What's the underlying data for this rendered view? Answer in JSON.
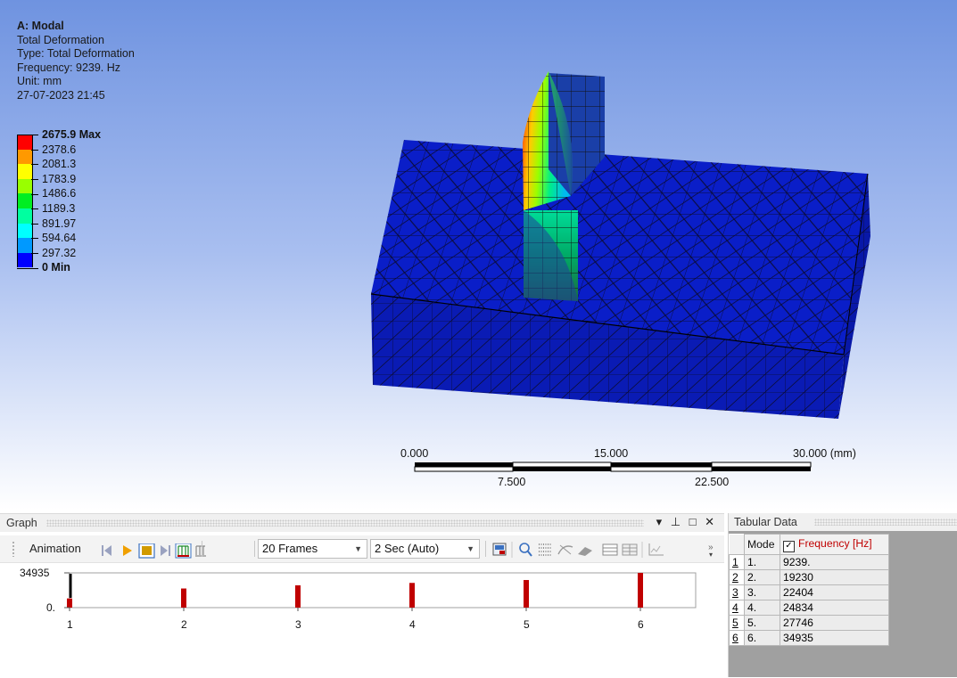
{
  "viewport": {
    "info": {
      "title": "A: Modal",
      "result": "Total Deformation",
      "type": "Type: Total Deformation",
      "frequency": "Frequency: 9239. Hz",
      "unit": "Unit: mm",
      "timestamp": "27-07-2023 21:45"
    },
    "legend": {
      "max_label": "2675.9 Max",
      "levels": [
        "2378.6",
        "2081.3",
        "1783.9",
        "1486.6",
        "1189.3",
        "891.97",
        "594.64",
        "297.32"
      ],
      "min_label": "0 Min",
      "colors": [
        "#ff0000",
        "#ff9900",
        "#ffff00",
        "#99ff00",
        "#00ee22",
        "#00ffa0",
        "#00ffff",
        "#0099ff",
        "#0000ff"
      ]
    },
    "scale": {
      "top_labels": [
        "0.000",
        "15.000",
        "30.000 (mm)"
      ],
      "bottom_labels": [
        "7.500",
        "22.500"
      ]
    }
  },
  "graph_panel": {
    "title": "Graph",
    "controls": "▾ ⊥ □ ✕",
    "toolbar": {
      "animation_label": "Animation",
      "frames_value": "20 Frames",
      "duration_value": "2 Sec (Auto)"
    }
  },
  "tabular_panel": {
    "title": "Tabular Data",
    "columns": [
      "Mode",
      "Frequency [Hz]"
    ],
    "rows": [
      {
        "index": "1",
        "mode": "1.",
        "frequency": "9239."
      },
      {
        "index": "2",
        "mode": "2.",
        "frequency": "19230"
      },
      {
        "index": "3",
        "mode": "3.",
        "frequency": "22404"
      },
      {
        "index": "4",
        "mode": "4.",
        "frequency": "24834"
      },
      {
        "index": "5",
        "mode": "5.",
        "frequency": "27746"
      },
      {
        "index": "6",
        "mode": "6.",
        "frequency": "34935"
      }
    ]
  },
  "chart_data": {
    "type": "bar",
    "categories": [
      "1",
      "2",
      "3",
      "4",
      "5",
      "6"
    ],
    "values": [
      9239,
      19230,
      22404,
      24834,
      27746,
      34935
    ],
    "ylim": [
      0,
      34935
    ],
    "y_ticks": [
      "34935",
      "0."
    ],
    "current_mode_label": "1.",
    "colors": {
      "bar": "#c00000",
      "cursor": "#000000"
    }
  }
}
